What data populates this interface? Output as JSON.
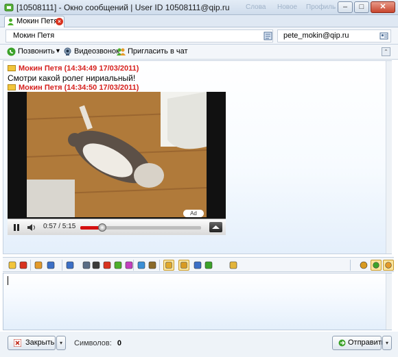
{
  "window": {
    "title": "[10508111] - Окно сообщений | User ID 10508111@qip.ru",
    "ghost_menu": [
      "Слова",
      "Новое",
      "Профиль"
    ],
    "controls": {
      "minimize": "–",
      "maximize": "□",
      "close": "✕"
    }
  },
  "tab": {
    "label": "Мокин Петя",
    "close_glyph": "×"
  },
  "contact": {
    "name": "Мокин Петя",
    "email": "pete_mokin@qip.ru"
  },
  "actions": {
    "call": "Позвонить",
    "video_call": "Видеозвонок",
    "invite": "Пригласить в чат",
    "collapse_glyph": "⌃"
  },
  "messages": [
    {
      "header": "Мокин Петя (14:34:49 17/03/2011)",
      "text": "Смотри какой ролег нириальный!"
    },
    {
      "header": "Мокин Петя (14:34:50 17/03/2011)"
    }
  ],
  "video": {
    "time": "0:57 / 5:15",
    "progress": 0.181,
    "ad_label": "Ad"
  },
  "format_icons": [
    "smiley-icon",
    "hearts-icon",
    "emoticons-icon",
    "calendar-icon",
    "save-icon",
    "screenshot-icon",
    "camera-icon",
    "sms-icon",
    "contacts-icon",
    "globe-icon",
    "send-file-icon",
    "settings-icon",
    "quote-icon",
    "history-icon",
    "translit-icon",
    "file-transfer-icon",
    "folder-icon"
  ],
  "bottom": {
    "close_label": "Закрыть",
    "chars_label": "Символов:",
    "chars_count": "0",
    "send_label": "Отправить",
    "dropdown_glyph": "▾"
  },
  "colors": {
    "accent_red": "#d6201d",
    "chrome": "#f3f6fa",
    "selected_icon": "#fbe59c"
  }
}
